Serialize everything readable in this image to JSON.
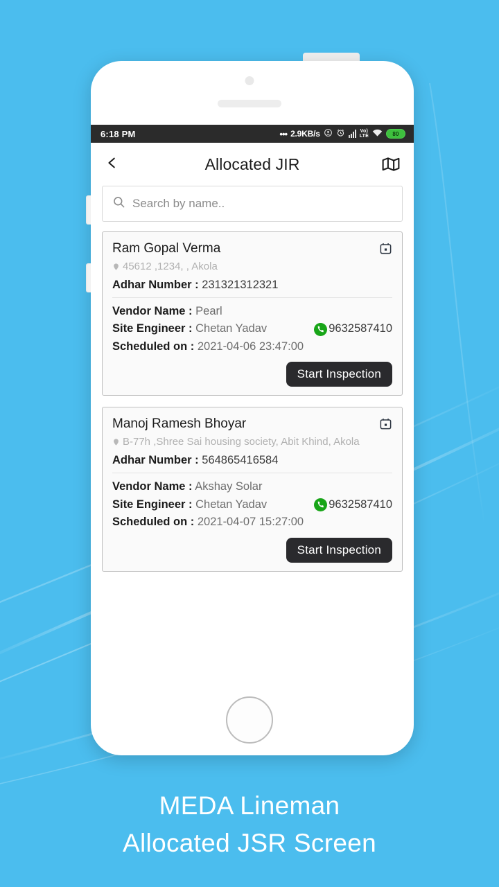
{
  "background": {
    "color": "#4bbdee"
  },
  "caption": {
    "line1": "MEDA Lineman",
    "line2": "Allocated JSR Screen"
  },
  "status_bar": {
    "time": "6:18 PM",
    "dots": "•••",
    "data_rate": "2.9KB/s",
    "icons": [
      "location-icon",
      "alarm-icon",
      "signal-icon",
      "volte-icon",
      "wifi-icon",
      "battery-icon"
    ],
    "volte_top": "VoLTE",
    "volte_label_line1": "Vo)",
    "volte_label_line2": "LTE",
    "battery_level": "80"
  },
  "app_bar": {
    "back_icon": "back-chevron-icon",
    "title": "Allocated JIR",
    "map_icon": "map-icon"
  },
  "search": {
    "placeholder": "Search by name..",
    "value": "",
    "icon": "search-icon"
  },
  "labels": {
    "adhar": "Adhar Number :",
    "vendor": "Vendor Name :",
    "engineer": "Site Engineer :",
    "scheduled": "Scheduled on :",
    "start_button": "Start Inspection"
  },
  "cards": [
    {
      "name": "Ram Gopal Verma",
      "address": "45612 ,1234, , Akola",
      "adhar_number": "231321312321",
      "vendor_name": "Pearl",
      "site_engineer": "Chetan Yadav",
      "phone": "9632587410",
      "scheduled_on": "2021-04-06 23:47:00",
      "calendar_icon": "calendar-icon",
      "pin_icon": "location-pin-icon",
      "phone_icon": "phone-call-icon"
    },
    {
      "name": "Manoj Ramesh Bhoyar",
      "address": "B-77h ,Shree Sai housing society, Abit Khind, Akola",
      "adhar_number": "564865416584",
      "vendor_name": "Akshay Solar",
      "site_engineer": "Chetan Yadav",
      "phone": "9632587410",
      "scheduled_on": "2021-04-07 15:27:00",
      "calendar_icon": "calendar-icon",
      "pin_icon": "location-pin-icon",
      "phone_icon": "phone-call-icon"
    }
  ],
  "colors": {
    "background_blue": "#4bbdee",
    "button_dark": "#2a2a2d",
    "phone_green": "#18a518",
    "battery_green": "#3ec03e",
    "status_bar": "#2b2b2b"
  }
}
